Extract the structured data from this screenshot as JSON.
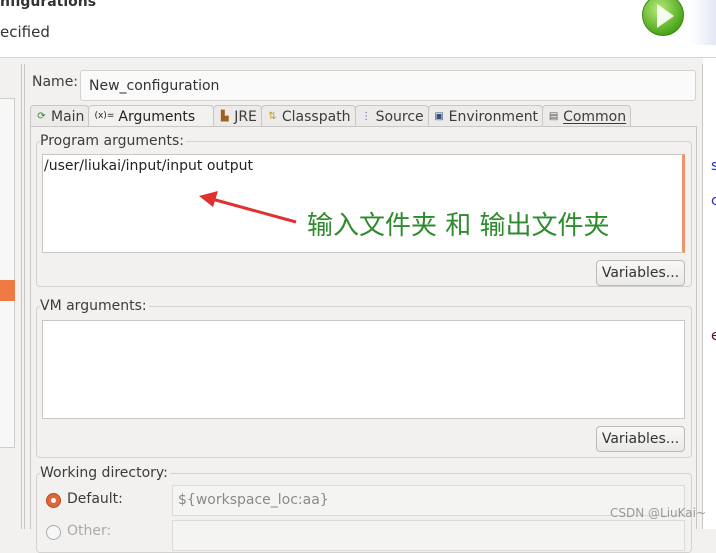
{
  "header": {
    "title": "nfigurations",
    "subtitle": "ecified",
    "run_icon": "run-icon",
    "colors": {
      "run": "#4fa51c"
    }
  },
  "name": {
    "label": "Name:",
    "value": "New_configuration"
  },
  "tabs": [
    {
      "label": "Main",
      "icon": "main-icon"
    },
    {
      "label": "Arguments",
      "icon": "arguments-icon",
      "active": true
    },
    {
      "label": "JRE",
      "icon": "jre-icon"
    },
    {
      "label": "Classpath",
      "icon": "classpath-icon"
    },
    {
      "label": "Source",
      "icon": "source-icon"
    },
    {
      "label": "Environment",
      "icon": "environment-icon"
    },
    {
      "label": "Common",
      "icon": "common-icon"
    }
  ],
  "program_args": {
    "label": "Program arguments:",
    "value": "/user/liukai/input/input output",
    "variables": "Variables..."
  },
  "vm_args": {
    "label": "VM arguments:",
    "value": "",
    "variables": "Variables..."
  },
  "working_dir": {
    "label": "Working directory:",
    "default_label": "Default:",
    "default_value": "${workspace_loc:aa}",
    "other_label": "Other:"
  },
  "annotation": {
    "text": "输入文件夹 和 输出文件夹",
    "color": "#2e8b2e",
    "arrow_color": "#e03030"
  },
  "watermark": "CSDN @LiuKai~"
}
